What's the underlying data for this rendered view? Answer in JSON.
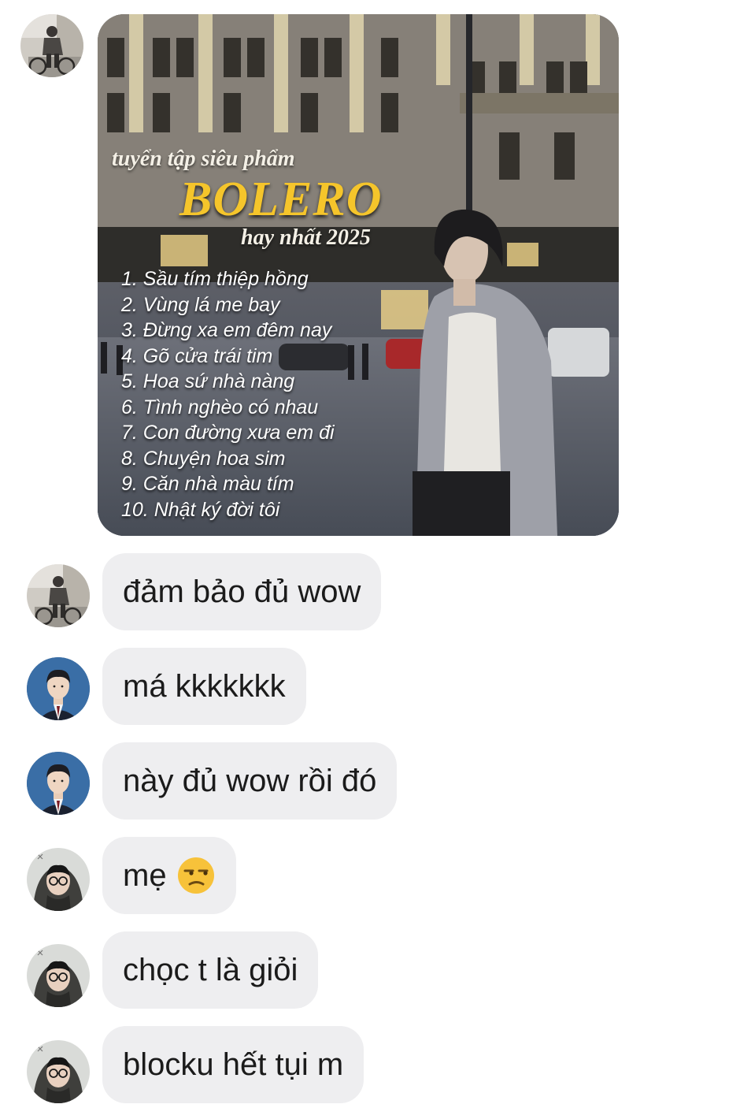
{
  "image_message": {
    "cover_line_1": "tuyển tập siêu phẩm",
    "cover_line_2": "BOLERO",
    "cover_line_3": "hay nhất 2025",
    "tracks": [
      "1. Sầu tím thiệp hồng",
      "2. Vùng lá me bay",
      "3. Đừng xa em đêm nay",
      "4. Gõ cửa trái tim",
      "5. Hoa sứ nhà nàng",
      "6. Tình nghèo có nhau",
      "7. Con đường xưa em đi",
      "8. Chuyện hoa sim",
      "9. Căn nhà màu tím",
      "10. Nhật ký đời tôi"
    ]
  },
  "messages": [
    {
      "text": "đảm bảo đủ wow",
      "avatar": "avatar-cyclist"
    },
    {
      "text": "má kkkkkkk",
      "avatar": "avatar-suit-man"
    },
    {
      "text": "này đủ wow rồi đó",
      "avatar": "avatar-suit-man"
    },
    {
      "text": "mẹ",
      "emoji": "unamused-face-icon",
      "avatar": "avatar-hooded-glasses"
    },
    {
      "text": "chọc t là giỏi",
      "avatar": "avatar-hooded-glasses"
    },
    {
      "text": "blocku hết tụi m",
      "avatar": "avatar-hooded-glasses"
    }
  ],
  "colors": {
    "bubble_bg": "#eeeef0",
    "bubble_text": "#1b1b1b",
    "cover_gold": "#f5c52b"
  }
}
